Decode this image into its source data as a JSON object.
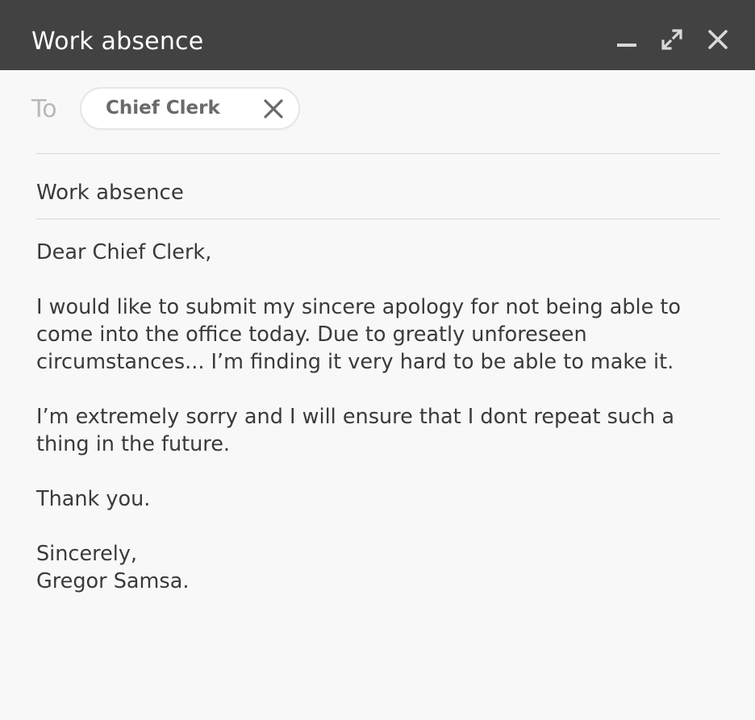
{
  "window": {
    "title": "Work absence",
    "colors": {
      "titlebar": "#424242",
      "background": "#f8f8f8"
    }
  },
  "controls": {
    "minimize_icon": "minimize-icon",
    "maximize_icon": "expand-icon",
    "close_icon": "close-icon"
  },
  "recipients": {
    "label": "To",
    "chips": [
      {
        "name": "Chief Clerk",
        "remove_icon": "close-icon"
      }
    ]
  },
  "subject": "Work absence",
  "body": {
    "greeting": "Dear Chief Clerk,",
    "paragraph_1_line_1": "I would like to submit my sincere apology for not being able to",
    "paragraph_1_line_2": "come into the office today. Due to greatly unforeseen",
    "paragraph_1_line_3": "circumstances... I’m finding it very hard to be able to make it.",
    "paragraph_2_line_1": "I’m extremely sorry and I will ensure that I dont repeat such a",
    "paragraph_2_line_2": "thing in the future.",
    "thanks": "Thank you.",
    "closing": "Sincerely,",
    "signature": "Gregor Samsa."
  }
}
